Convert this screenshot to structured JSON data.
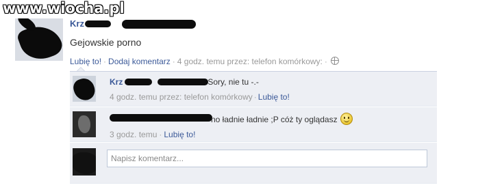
{
  "watermark": "www.wiocha.pl",
  "post": {
    "author_visible": "Krz",
    "text": "Gejowskie porno",
    "like_label": "Lubię to!",
    "comment_label": "Dodaj komentarz",
    "meta_text": "4 godz. temu przez: telefon komórkowy:",
    "separator": "·",
    "privacy_icon": "globe-icon"
  },
  "comments": [
    {
      "author_visible": "Krz",
      "text": "Sory, nie tu -.-",
      "meta_text": "4 godz. temu przez: telefon komórkowy",
      "like_label": "Lubię to!"
    },
    {
      "text": "no ładnie ładnie ;P cóż ty oglądasz",
      "emoticon": "smile-icon",
      "meta_text": "3 godz. temu",
      "like_label": "Lubię to!"
    }
  ],
  "new_comment": {
    "placeholder": "Napisz komentarz..."
  },
  "colors": {
    "link": "#3b5998",
    "meta": "#999999",
    "comment_bg": "#edeff4",
    "input_border": "#bdc7d8"
  }
}
